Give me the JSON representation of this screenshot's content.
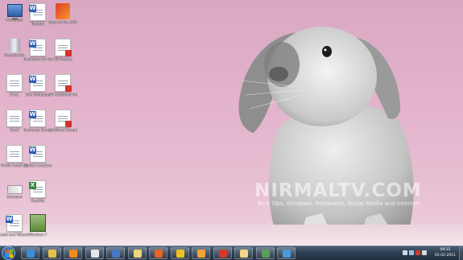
{
  "desktop": {
    "icons": [
      {
        "label": "Computer",
        "icon": "computer-icon"
      },
      {
        "label": "Recycle Bin",
        "icon": "recycle-bin-icon"
      },
      {
        "label": "Doc1",
        "icon": "text-file-icon"
      },
      {
        "label": "Doc2",
        "icon": "text-file-icon"
      },
      {
        "label": "Profile Install 32",
        "icon": "text-file-icon"
      },
      {
        "label": "Unknown",
        "icon": "unknown-file-icon"
      },
      {
        "label": "Lobo and Vibrant Ballpoint",
        "icon": "word-doc-icon"
      },
      {
        "label": "Receipt",
        "icon": "word-doc-icon"
      },
      {
        "label": "Resolution for Support",
        "icon": "word-doc-icon"
      },
      {
        "label": "Win Wallpaper",
        "icon": "word-doc-icon"
      },
      {
        "label": "Exchange Server",
        "icon": "word-doc-icon"
      },
      {
        "label": "Update Locations",
        "icon": "word-doc-icon"
      },
      {
        "label": "HostFile",
        "icon": "excel-doc-icon"
      },
      {
        "label": "Windows 7",
        "icon": "vmware-icon"
      },
      {
        "label": "Icons of the x300 Phones",
        "icon": "flash-file-icon"
      },
      {
        "label": "WP Frames",
        "icon": "pdf-doc-icon"
      },
      {
        "label": "WP Additional Items",
        "icon": "pdf-doc-icon"
      },
      {
        "label": "Additional Symptoms",
        "icon": "pdf-doc-icon"
      }
    ],
    "watermark": {
      "title": "NIRMALTV.COM",
      "subtitle": "Tech Tips, Windows, Freewares, Social Media and Internet"
    }
  },
  "taskbar": {
    "start_icon": "windows-start-icon",
    "pinned": [
      {
        "name": "internet-explorer-icon",
        "color": "#3a8fd8"
      },
      {
        "name": "file-explorer-icon",
        "color": "#e8c04a"
      },
      {
        "name": "media-player-icon",
        "color": "#f08a1a"
      },
      {
        "name": "hp-icon",
        "color": "#e6e6e6"
      },
      {
        "name": "task-checklist-icon",
        "color": "#4a78c8"
      },
      {
        "name": "pen-tool-icon",
        "color": "#e9d77a"
      },
      {
        "name": "firefox-icon",
        "color": "#e8641e"
      },
      {
        "name": "mail-icon",
        "color": "#f0c21e"
      },
      {
        "name": "outlook-icon",
        "color": "#f2a43a"
      },
      {
        "name": "chrome-icon",
        "color": "#d9372b"
      },
      {
        "name": "folder-icon",
        "color": "#f2d48a"
      },
      {
        "name": "network-people-icon",
        "color": "#5aa05a"
      },
      {
        "name": "remote-desktop-icon",
        "color": "#4a9ad8"
      }
    ],
    "tray": {
      "time": "09:25",
      "date": "02-02-2011"
    }
  }
}
